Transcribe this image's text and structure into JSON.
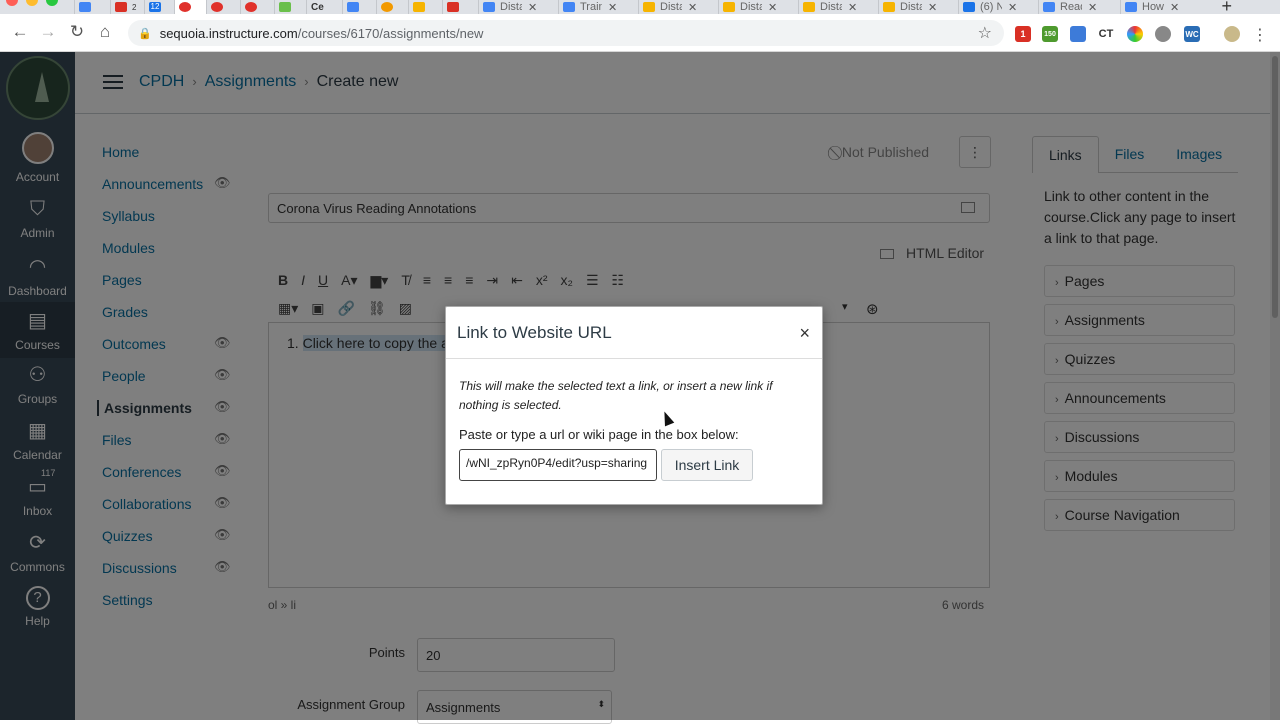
{
  "browser": {
    "tabs": [
      {
        "label": ""
      },
      {
        "label": "2"
      },
      {
        "label": "12"
      },
      {
        "label": ""
      },
      {
        "label": ""
      },
      {
        "label": ""
      },
      {
        "label": ""
      },
      {
        "label": "Ce"
      },
      {
        "label": ""
      },
      {
        "label": ""
      },
      {
        "label": ""
      },
      {
        "label": ""
      },
      {
        "label": "Dista"
      },
      {
        "label": "Traini"
      },
      {
        "label": "Dista"
      },
      {
        "label": "Dista"
      },
      {
        "label": "Dista"
      },
      {
        "label": "Dista"
      },
      {
        "label": "(6) N"
      },
      {
        "label": "Read"
      },
      {
        "label": "How"
      }
    ],
    "url_host": "sequoia.instructure.com",
    "url_path": "/courses/6170/assignments/new",
    "extensions": {
      "mail_badge": "1",
      "counter": "150",
      "ct": "CT",
      "wc": "WC"
    }
  },
  "global_nav": {
    "items": [
      {
        "label": "Account"
      },
      {
        "label": "Admin"
      },
      {
        "label": "Dashboard"
      },
      {
        "label": "Courses"
      },
      {
        "label": "Groups"
      },
      {
        "label": "Calendar"
      },
      {
        "label": "Inbox",
        "badge": "117"
      },
      {
        "label": "Commons"
      },
      {
        "label": "Help"
      }
    ]
  },
  "breadcrumb": {
    "course": "CPDH",
    "section": "Assignments",
    "current": "Create new"
  },
  "course_nav": {
    "items": [
      {
        "label": "Home"
      },
      {
        "label": "Announcements"
      },
      {
        "label": "Syllabus"
      },
      {
        "label": "Modules"
      },
      {
        "label": "Pages"
      },
      {
        "label": "Grades"
      },
      {
        "label": "Outcomes"
      },
      {
        "label": "People"
      },
      {
        "label": "Assignments"
      },
      {
        "label": "Files"
      },
      {
        "label": "Conferences"
      },
      {
        "label": "Collaborations"
      },
      {
        "label": "Quizzes"
      },
      {
        "label": "Discussions"
      },
      {
        "label": "Settings"
      }
    ]
  },
  "editor": {
    "status": "Not Published",
    "title_value": "Corona Virus Reading Annotations",
    "html_editor_label": "HTML Editor",
    "line_number": "1.",
    "line_text": "Click here to copy the a",
    "path": "ol » li",
    "word_count": "6 words",
    "points_label": "Points",
    "points_value": "20",
    "group_label": "Assignment Group",
    "group_value": "Assignments"
  },
  "right_panel": {
    "tabs": [
      {
        "label": "Links"
      },
      {
        "label": "Files"
      },
      {
        "label": "Images"
      }
    ],
    "description": "Link to other content in the course.Click any page to insert a link to that page.",
    "sections": [
      {
        "label": "Pages"
      },
      {
        "label": "Assignments"
      },
      {
        "label": "Quizzes"
      },
      {
        "label": "Announcements"
      },
      {
        "label": "Discussions"
      },
      {
        "label": "Modules"
      },
      {
        "label": "Course Navigation"
      }
    ]
  },
  "dialog": {
    "title": "Link to Website URL",
    "close": "×",
    "note": "This will make the selected text a link, or insert a new link if nothing is selected.",
    "input_label": "Paste or type a url or wiki page in the box below:",
    "input_value": "/wNI_zpRyn0P4/edit?usp=sharing",
    "insert_button": "Insert Link"
  },
  "colors": {
    "global_nav": "#394b58",
    "link": "#0770a3",
    "text": "#2d3b45"
  }
}
